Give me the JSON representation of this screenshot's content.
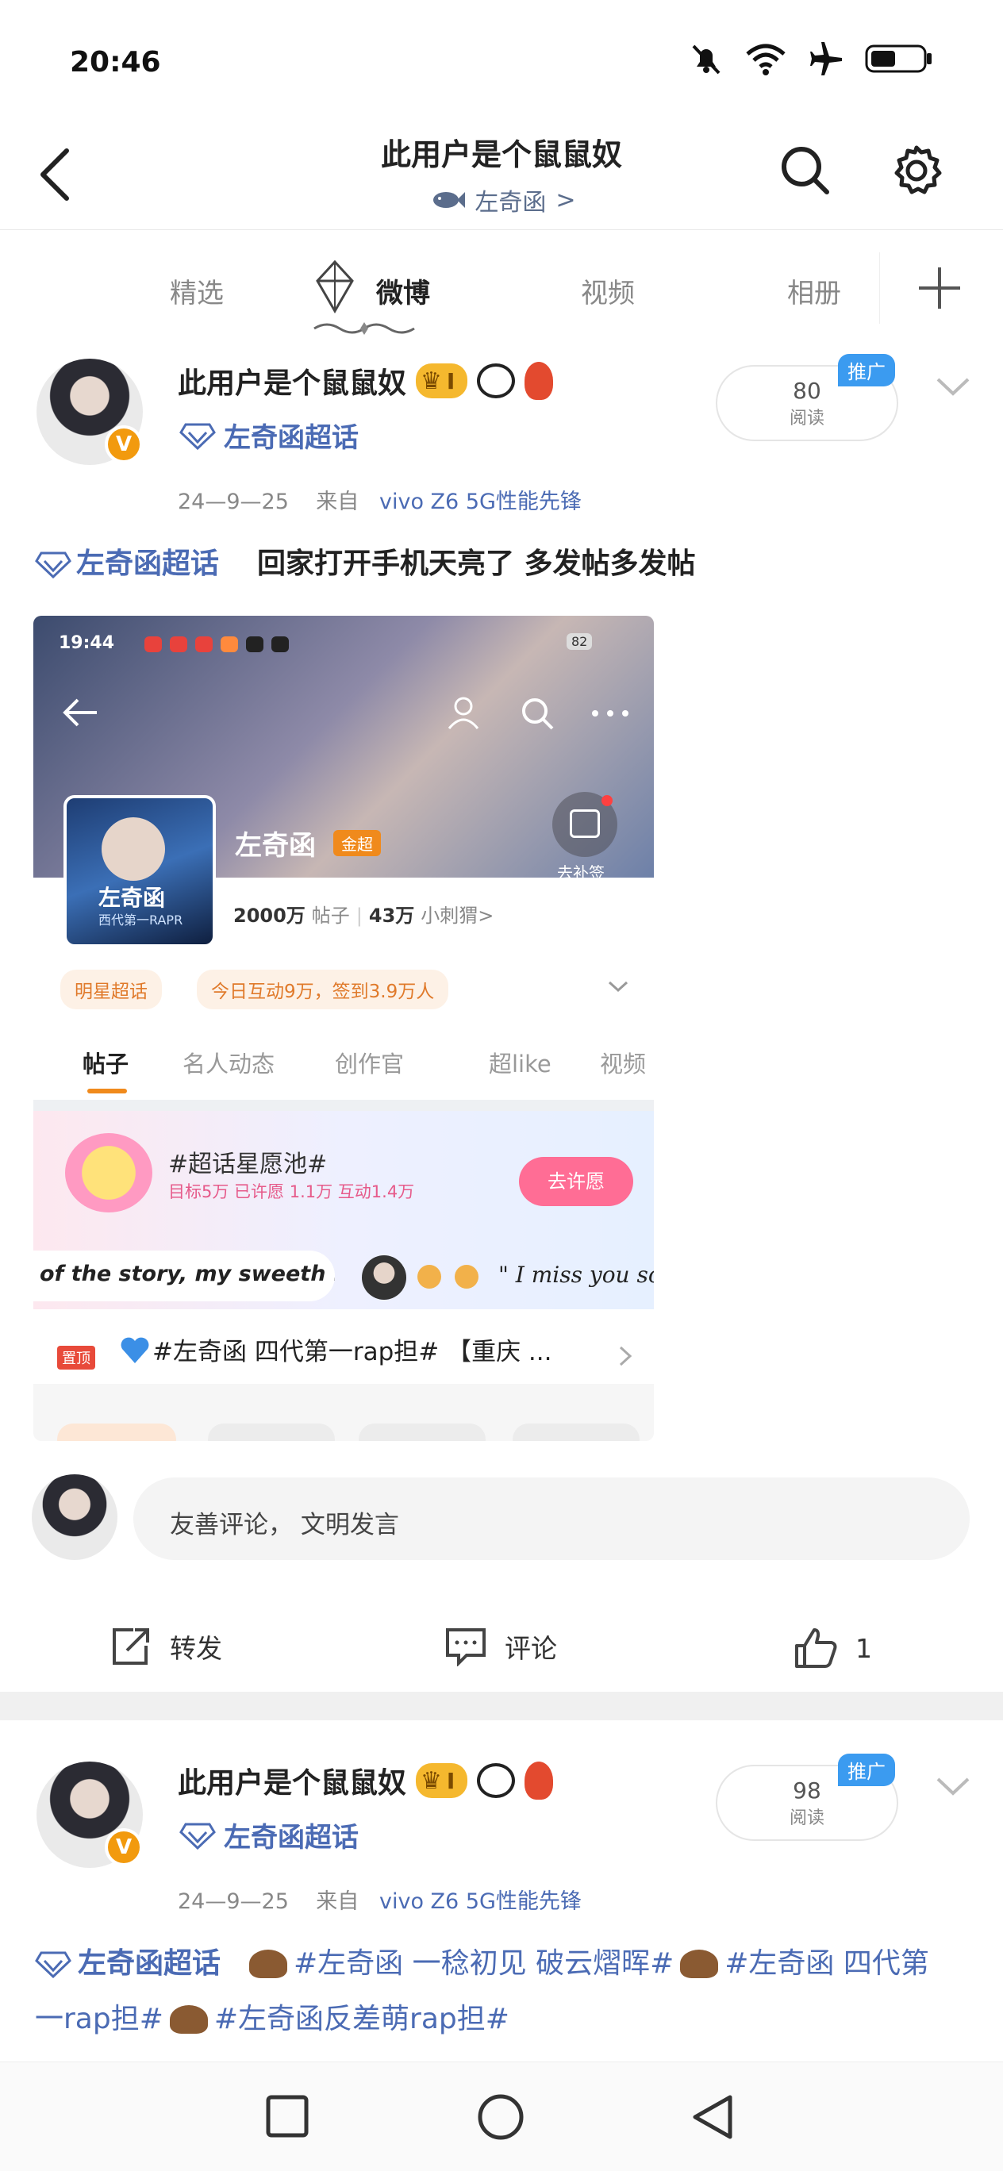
{
  "status": {
    "time": "20:46"
  },
  "header": {
    "title": "此用户是个鼠鼠奴",
    "subtitle": "左奇函",
    "subtitle_arrow": ">"
  },
  "tabs": [
    {
      "label": "精选"
    },
    {
      "label": "微博"
    },
    {
      "label": "视频"
    },
    {
      "label": "相册"
    }
  ],
  "posts": [
    {
      "user": "此用户是个鼠鼠奴",
      "level": "I",
      "super_topic": "左奇函超话",
      "date": "24—9—25",
      "source_prefix": "来自",
      "device": "vivo  Z6  5G性能先锋",
      "read_count": "80",
      "read_label": "阅读",
      "promo": "推广",
      "topic": "左奇函超话",
      "body": "回家打开手机天亮了  多发帖多发帖"
    },
    {
      "user": "此用户是个鼠鼠奴",
      "level": "I",
      "super_topic": "左奇函超话",
      "date": "24—9—25",
      "source_prefix": "来自",
      "device": "vivo  Z6  5G性能先锋",
      "read_count": "98",
      "read_label": "阅读",
      "promo": "推广",
      "topic": "左奇函超话",
      "body_line1a": "#左奇函  一稔初见  破云熠晖#",
      "body_line1b": "#左奇函  四代第",
      "body_line2a": "一rap担#",
      "body_line2b": "#左奇函反差萌rap担#"
    }
  ],
  "screenshot": {
    "time": "19:44",
    "battery": "82",
    "name": "左奇函",
    "badge": "金超",
    "posts_count": "2000万",
    "posts_label": "帖子",
    "fans_count": "43万",
    "fans_label": "小刺猬>",
    "checkin": "去补签",
    "tag1": "明星超话",
    "tag2": "今日互动9万，签到3.9万人",
    "tabs": [
      "帖子",
      "名人动态",
      "创作官",
      "超like",
      "视频"
    ],
    "wish_title": "#超话星愿池#",
    "wish_stats": "目标5万  已许愿 1.1万  互动1.4万",
    "wish_btn": "去许愿",
    "marquee_left": "of the story, my sweeth ...",
    "marquee_right": "\" I miss you so m",
    "pin_label": "置顶",
    "pin_text": "#左奇函 四代第一rap担#  【重庆 ...",
    "cover_text": "左奇函",
    "cover_sub": "西代第一RAPR"
  },
  "comment": {
    "placeholder": "友善评论， 文明发言"
  },
  "actions": {
    "repost": "转发",
    "comment": "评论",
    "like_count": "1"
  },
  "colors": {
    "link": "#4b6bb4",
    "promo": "#3b9bf0",
    "gold": "#f5b82e"
  }
}
